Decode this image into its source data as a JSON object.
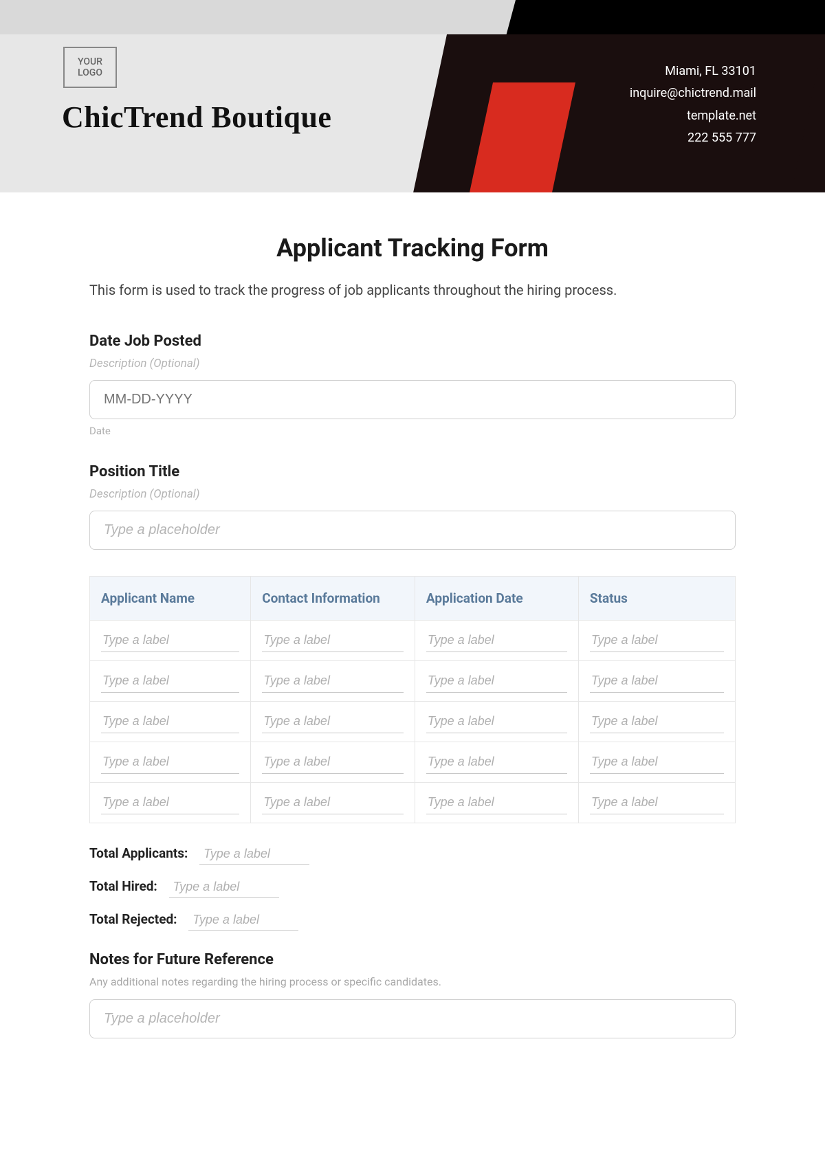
{
  "header": {
    "logo_text": "YOUR\nLOGO",
    "company_name": "ChicTrend Boutique",
    "contact": {
      "address": "Miami, FL 33101",
      "email": "inquire@chictrend.mail",
      "website": "template.net",
      "phone": "222 555 777"
    }
  },
  "form": {
    "title": "Applicant Tracking Form",
    "intro": "This form is used to track the progress of job applicants throughout the hiring process.",
    "date_posted": {
      "label": "Date Job Posted",
      "description": "Description (Optional)",
      "placeholder": "MM-DD-YYYY",
      "hint": "Date"
    },
    "position_title": {
      "label": "Position Title",
      "description": "Description (Optional)",
      "placeholder": "Type a placeholder"
    },
    "table": {
      "headers": [
        "Applicant Name",
        "Contact Information",
        "Application Date",
        "Status"
      ],
      "cell_placeholder": "Type a label",
      "rows": 5
    },
    "totals": {
      "applicants_label": "Total Applicants:",
      "hired_label": "Total Hired:",
      "rejected_label": "Total Rejected:",
      "placeholder": "Type a label"
    },
    "notes": {
      "label": "Notes for Future Reference",
      "description": "Any additional notes regarding the hiring process or specific candidates.",
      "placeholder": "Type a placeholder"
    }
  }
}
